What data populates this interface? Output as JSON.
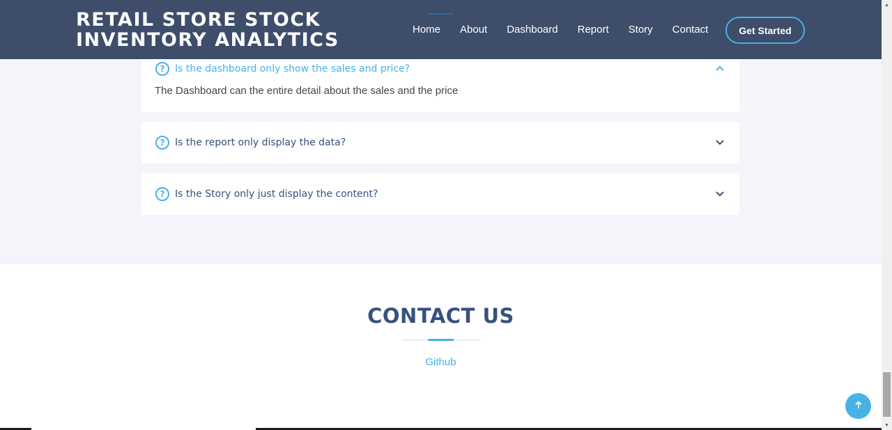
{
  "brand": {
    "line1": "RETAIL STORE STOCK",
    "line2": "INVENTORY ANALYTICS"
  },
  "nav": {
    "items": [
      "Home",
      "About",
      "Dashboard",
      "Report",
      "Story",
      "Contact"
    ],
    "cta": "Get Started",
    "active": "Home"
  },
  "faq": {
    "items": [
      {
        "question": "Is the dashboard only show the sales and price?",
        "answer": "The Dashboard can the entire detail about the sales and the price",
        "expanded": true
      },
      {
        "question": "Is the report only display the data?",
        "expanded": false
      },
      {
        "question": "Is the Story only just display the content?",
        "expanded": false
      }
    ]
  },
  "contact": {
    "title": "CONTACT US",
    "link": "Github"
  },
  "icons": {
    "question": "question-circle-icon",
    "expanded": "chevron-up-icon",
    "collapsed": "chevron-down-icon",
    "back_to_top": "arrow-up-icon"
  },
  "colors": {
    "header_bg": "#3d4d6a",
    "accent": "#47b2e4",
    "heading": "#37517e",
    "section_bg": "#f3f5fa"
  }
}
